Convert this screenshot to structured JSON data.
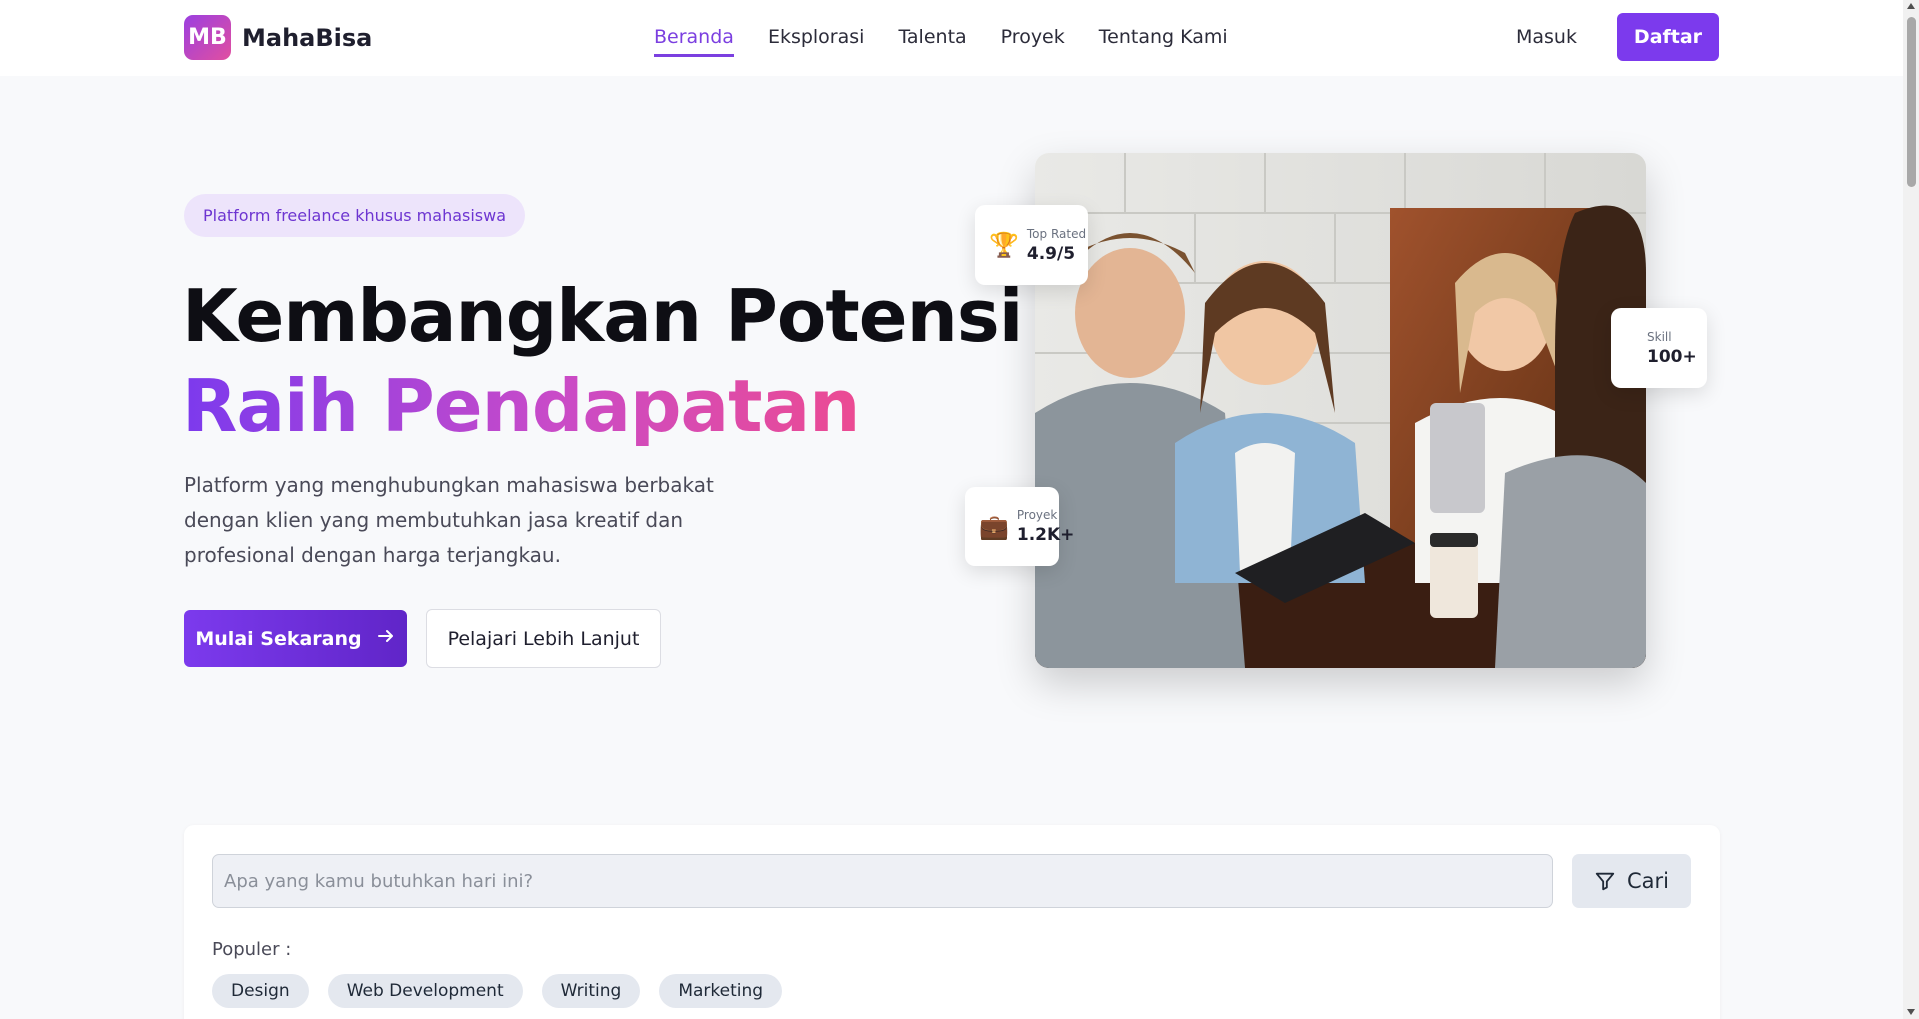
{
  "header": {
    "logo_mark": "MB",
    "brand": "MahaBisa",
    "nav": [
      {
        "label": "Beranda",
        "active": true
      },
      {
        "label": "Eksplorasi",
        "active": false
      },
      {
        "label": "Talenta",
        "active": false
      },
      {
        "label": "Proyek",
        "active": false
      },
      {
        "label": "Tentang Kami",
        "active": false
      }
    ],
    "login_label": "Masuk",
    "signup_label": "Daftar"
  },
  "hero": {
    "badge": "Platform freelance khusus mahasiswa",
    "headline_line1": "Kembangkan Potensi",
    "headline_line2": "Raih Pendapatan",
    "description": "Platform yang menghubungkan mahasiswa berbakat dengan klien yang membutuhkan jasa kreatif dan profesional dengan harga terjangkau.",
    "primary_cta": "Mulai Sekarang",
    "secondary_cta": "Pelajari Lebih Lanjut"
  },
  "stats": {
    "rated": {
      "icon": "trophy-icon",
      "label": "Top Rated",
      "value": "4.9/5"
    },
    "skill": {
      "label": "Skill",
      "value": "100+"
    },
    "proyek": {
      "icon": "briefcase-icon",
      "label": "Proyek",
      "value": "1.2K+"
    }
  },
  "search": {
    "placeholder": "Apa yang kamu butuhkan hari ini?",
    "button_label": "Cari",
    "popular_label": "Populer :",
    "popular_tags": [
      "Design",
      "Web Development",
      "Writing",
      "Marketing"
    ]
  },
  "colors": {
    "brand_purple": "#7c3aed",
    "gradient_pink": "#ec4b92",
    "badge_bg": "#ede4fb",
    "page_bg": "#f8f9fb"
  }
}
